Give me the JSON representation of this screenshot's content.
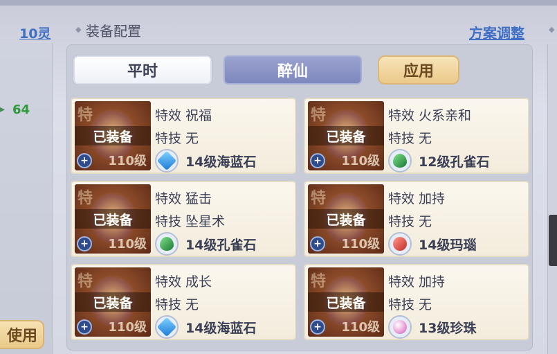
{
  "left_panel": {
    "spirit_link": "10灵",
    "value": "64",
    "use_button": "使用"
  },
  "header": {
    "title": "装备配置",
    "plan_link": "方案调整"
  },
  "tabs": [
    {
      "label": "平时",
      "active": true
    },
    {
      "label": "醉仙",
      "active": false
    }
  ],
  "apply_button": "应用",
  "cards": [
    {
      "equipped": "已装备",
      "level": "110级",
      "effect": "特效 祝福",
      "skill": "特技 无",
      "gem": "14级海蓝石",
      "gem_type": "blue"
    },
    {
      "equipped": "已装备",
      "level": "110级",
      "effect": "特效 火系亲和",
      "skill": "特技 无",
      "gem": "12级孔雀石",
      "gem_type": "green"
    },
    {
      "equipped": "已装备",
      "level": "110级",
      "effect": "特效 猛击",
      "skill": "特技 坠星术",
      "gem": "14级孔雀石",
      "gem_type": "green"
    },
    {
      "equipped": "已装备",
      "level": "110级",
      "effect": "特效 加持",
      "skill": "特技 无",
      "gem": "14级玛瑙",
      "gem_type": "red"
    },
    {
      "equipped": "已装备",
      "level": "110级",
      "effect": "特效 成长",
      "skill": "特技 无",
      "gem": "14级海蓝石",
      "gem_type": "blue"
    },
    {
      "equipped": "已装备",
      "level": "110级",
      "effect": "特效 加持",
      "skill": "特技 无",
      "gem": "13级珍珠",
      "gem_type": "pearl"
    }
  ],
  "colors": {
    "link": "#3f6fc4",
    "value_green": "#2f9a3c",
    "active_tab": "#ffffff",
    "inactive_tab": "#7f88bd",
    "apply": "#ecc98a"
  }
}
